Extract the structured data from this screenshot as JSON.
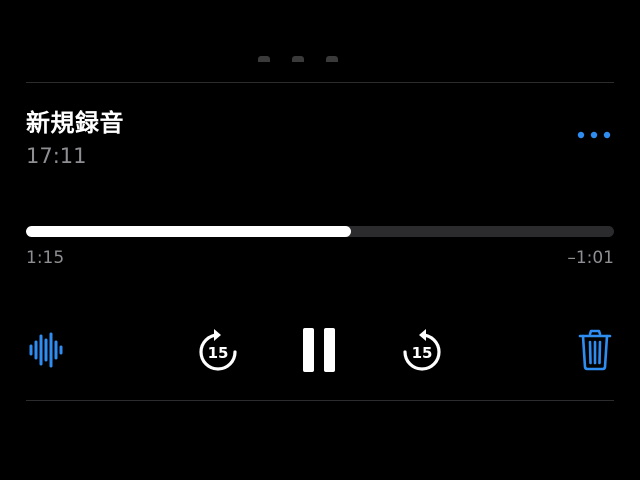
{
  "recording": {
    "title": "新規録音",
    "time": "17:11"
  },
  "playback": {
    "elapsed": "1:15",
    "remaining": "–1:01",
    "progress_fraction": 0.553
  },
  "controls": {
    "skip_back_seconds": "15",
    "skip_forward_seconds": "15"
  },
  "icons": {
    "more": "more-horizontal-icon",
    "waveform": "waveform-icon",
    "skip_back": "skip-back-15-icon",
    "pause": "pause-icon",
    "skip_forward": "skip-forward-15-icon",
    "delete": "trash-icon"
  },
  "colors": {
    "background": "#000000",
    "accent": "#2f8cf0",
    "text_primary": "#ffffff",
    "text_secondary": "#8e8e93",
    "track": "#2b2b2d"
  }
}
